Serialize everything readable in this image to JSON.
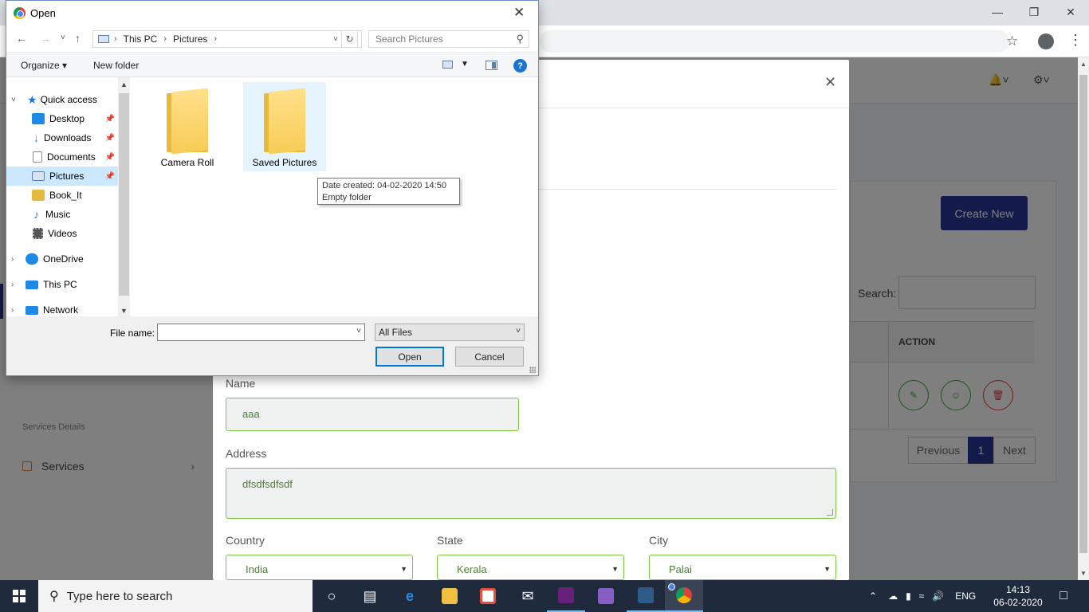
{
  "dialog": {
    "title": "Open",
    "path": [
      "This PC",
      "Pictures"
    ],
    "search_placeholder": "Search Pictures",
    "organize_label": "Organize",
    "new_folder_label": "New folder",
    "help_label": "?",
    "nav_items": [
      {
        "label": "Quick access",
        "icon": "star-icon",
        "color": "#1e74d1"
      },
      {
        "label": "Desktop",
        "icon": "desktop-icon",
        "color": "#1e88e5"
      },
      {
        "label": "Downloads",
        "icon": "download-arrow-icon",
        "color": "#1e88e5"
      },
      {
        "label": "Documents",
        "icon": "document-icon",
        "color": "#8a8a8a"
      },
      {
        "label": "Pictures",
        "icon": "pictures-icon",
        "color": "#5a7fb5"
      },
      {
        "label": "Book_It",
        "icon": "folder-check-icon",
        "color": "#e8b93f"
      },
      {
        "label": "Music",
        "icon": "music-note-icon",
        "color": "#1e88e5"
      },
      {
        "label": "Videos",
        "icon": "film-icon",
        "color": "#555555"
      },
      {
        "label": "OneDrive",
        "icon": "cloud-icon",
        "color": "#1e88e5"
      },
      {
        "label": "This PC",
        "icon": "computer-icon",
        "color": "#1e88e5"
      },
      {
        "label": "Network",
        "icon": "network-icon",
        "color": "#1e88e5"
      }
    ],
    "folders": [
      {
        "name": "Camera Roll"
      },
      {
        "name": "Saved Pictures"
      }
    ],
    "tooltip": {
      "line1": "Date created: 04-02-2020 14:50",
      "line2": "Empty folder"
    },
    "file_name_label": "File name:",
    "file_name_value": "",
    "file_type": "All Files",
    "open_label": "Open",
    "cancel_label": "Cancel"
  },
  "page": {
    "create_new_label": "Create New",
    "search_label": "Search:",
    "table_header_action": "ACTION",
    "pager": {
      "previous": "Previous",
      "current": "1",
      "next": "Next"
    },
    "sidebar": {
      "section_label": "Services Details",
      "item_label": "Services"
    }
  },
  "form": {
    "name_label": "Name",
    "name_value": "aaa",
    "address_label": "Address",
    "address_value": "dfsdfsdfsdf",
    "country_label": "Country",
    "country_value": "India",
    "state_label": "State",
    "state_value": "Kerala",
    "city_label": "City",
    "city_value": "Palai"
  },
  "taskbar": {
    "search_placeholder": "Type here to search",
    "language": "ENG",
    "time": "14:13",
    "date": "06-02-2020"
  },
  "colors": {
    "primary": "#283593",
    "success": "#39a935",
    "danger": "#e53935",
    "field_border": "#7cc443"
  }
}
